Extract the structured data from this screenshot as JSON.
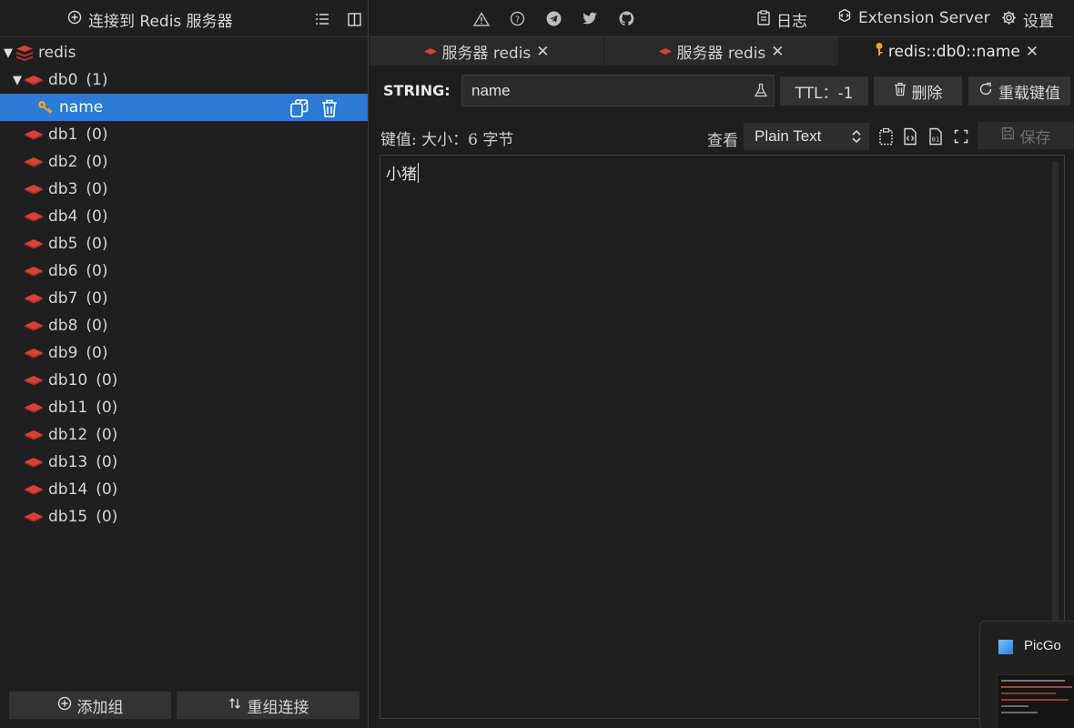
{
  "left_panel": {
    "connect_label": "连接到 Redis 服务器",
    "tree": {
      "server_name": "redis",
      "databases": [
        {
          "name": "db0",
          "count": "(1)",
          "expanded": true
        },
        {
          "name": "db1",
          "count": "(0)"
        },
        {
          "name": "db2",
          "count": "(0)"
        },
        {
          "name": "db3",
          "count": "(0)"
        },
        {
          "name": "db4",
          "count": "(0)"
        },
        {
          "name": "db5",
          "count": "(0)"
        },
        {
          "name": "db6",
          "count": "(0)"
        },
        {
          "name": "db7",
          "count": "(0)"
        },
        {
          "name": "db8",
          "count": "(0)"
        },
        {
          "name": "db9",
          "count": "(0)"
        },
        {
          "name": "db10",
          "count": "(0)"
        },
        {
          "name": "db11",
          "count": "(0)"
        },
        {
          "name": "db12",
          "count": "(0)"
        },
        {
          "name": "db13",
          "count": "(0)"
        },
        {
          "name": "db14",
          "count": "(0)"
        },
        {
          "name": "db15",
          "count": "(0)"
        }
      ],
      "selected_key": "name"
    },
    "add_group_label": "添加组",
    "reconnect_label": "重组连接"
  },
  "topbar": {
    "log_label": "日志",
    "extension_label": "Extension Server",
    "settings_label": "设置"
  },
  "tabs": [
    {
      "label": "服务器 redis",
      "active": false
    },
    {
      "label": "服务器 redis",
      "active": false
    },
    {
      "label": "redis::db0::name",
      "active": true
    }
  ],
  "key_bar": {
    "type_label": "STRING:",
    "key_value": "name",
    "ttl_label": "TTL：-1",
    "delete_label": "删除",
    "reload_label": "重载键值"
  },
  "value_bar": {
    "size_label": "键值: 大小：6 字节",
    "view_label": "查看",
    "view_mode": "Plain Text",
    "save_label": "保存"
  },
  "editor": {
    "value": "小猪"
  },
  "notification": {
    "title": "PicGo"
  },
  "colors": {
    "accent": "#2a7ad6",
    "redis_red": "#d9403a",
    "key_gold": "#e0a631",
    "background": "#1e1e1e"
  }
}
